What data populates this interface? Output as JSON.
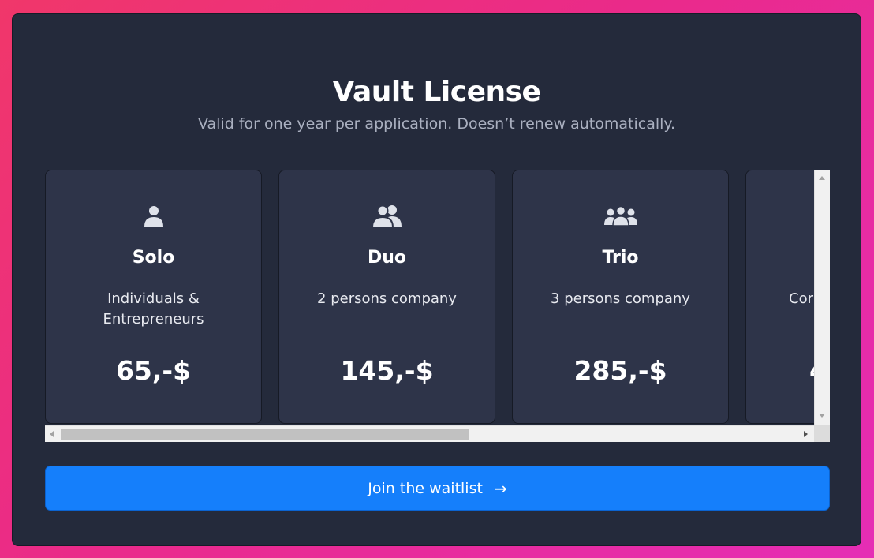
{
  "header": {
    "title": "Vault License",
    "subtitle": "Valid for one year per application. Doesn’t renew automatically."
  },
  "plans": [
    {
      "icon": "person-icon",
      "name": "Solo",
      "desc": "Individuals & Entrepreneurs",
      "price": "65,-$"
    },
    {
      "icon": "two-persons-icon",
      "name": "Duo",
      "desc": "2 persons company",
      "price": "145,-$"
    },
    {
      "icon": "group-icon",
      "name": "Trio",
      "desc": "3 persons company",
      "price": "285,-$"
    },
    {
      "icon": "",
      "name": "",
      "desc": "Cor",
      "price": "4"
    }
  ],
  "cta": {
    "label": "Join the waitlist",
    "arrow": "→"
  },
  "scrollbar": {
    "horizontal_position_fraction": 0.0,
    "horizontal_visible_fraction": 0.55
  }
}
